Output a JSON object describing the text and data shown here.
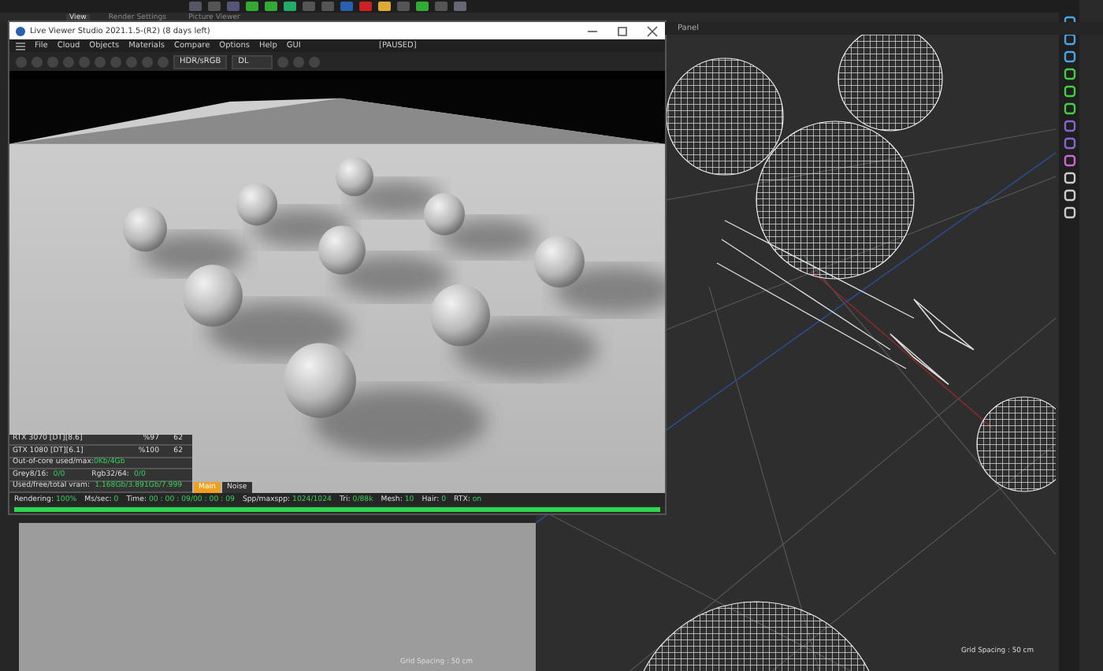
{
  "app_tabs": [
    {
      "label": "View",
      "selected": true
    },
    {
      "label": "Render Settings",
      "selected": false
    },
    {
      "label": "Picture Viewer",
      "selected": false
    }
  ],
  "live_viewer": {
    "title": "Live Viewer Studio 2021.1.5-(R2) (8 days left)",
    "menu": [
      "File",
      "Cloud",
      "Objects",
      "Materials",
      "Compare",
      "Options",
      "Help",
      "GUI"
    ],
    "state": "[PAUSED]",
    "color_mode": "HDR/sRGB",
    "kernel": "DL",
    "gpus": [
      {
        "name": "RTX 3070 [DT][8.6]",
        "usage": "%97",
        "temp": "62"
      },
      {
        "name": "GTX 1080 [DT][6.1]",
        "usage": "%100",
        "temp": "62"
      }
    ],
    "out_of_core": {
      "label": "Out-of-core used/max:",
      "value": "0Kb/4Gb"
    },
    "textures": [
      {
        "label": "Grey8/16:",
        "value": "0/0"
      },
      {
        "label": "Rgb32/64:",
        "value": "0/0"
      }
    ],
    "vram": {
      "label": "Used/free/total vram:",
      "value": "1.168Gb/3.891Gb/7.999"
    },
    "passes": [
      {
        "label": "Main",
        "selected": true
      },
      {
        "label": "Noise",
        "selected": false
      }
    ],
    "status_bar": [
      {
        "label": "Rendering:",
        "value": "100%"
      },
      {
        "label": "Ms/sec:",
        "value": "0"
      },
      {
        "label": "Time:",
        "value": "00 : 00 : 09/00 : 00 : 09"
      },
      {
        "label": "Spp/maxspp:",
        "value": "1024/1024"
      },
      {
        "label": "Tri:",
        "value": "0/88k"
      },
      {
        "label": "Mesh:",
        "value": "10"
      },
      {
        "label": "Hair:",
        "value": "0"
      },
      {
        "label": "RTX:",
        "value": "on"
      }
    ],
    "progress": {
      "level": 1
    }
  },
  "viewports": [
    {
      "kind": "shaded",
      "grid_spacing": "Grid Spacing : 50 cm"
    },
    {
      "kind": "wireframe",
      "panel_label": "Panel",
      "grid_spacing": "Grid Spacing : 50 cm"
    }
  ]
}
